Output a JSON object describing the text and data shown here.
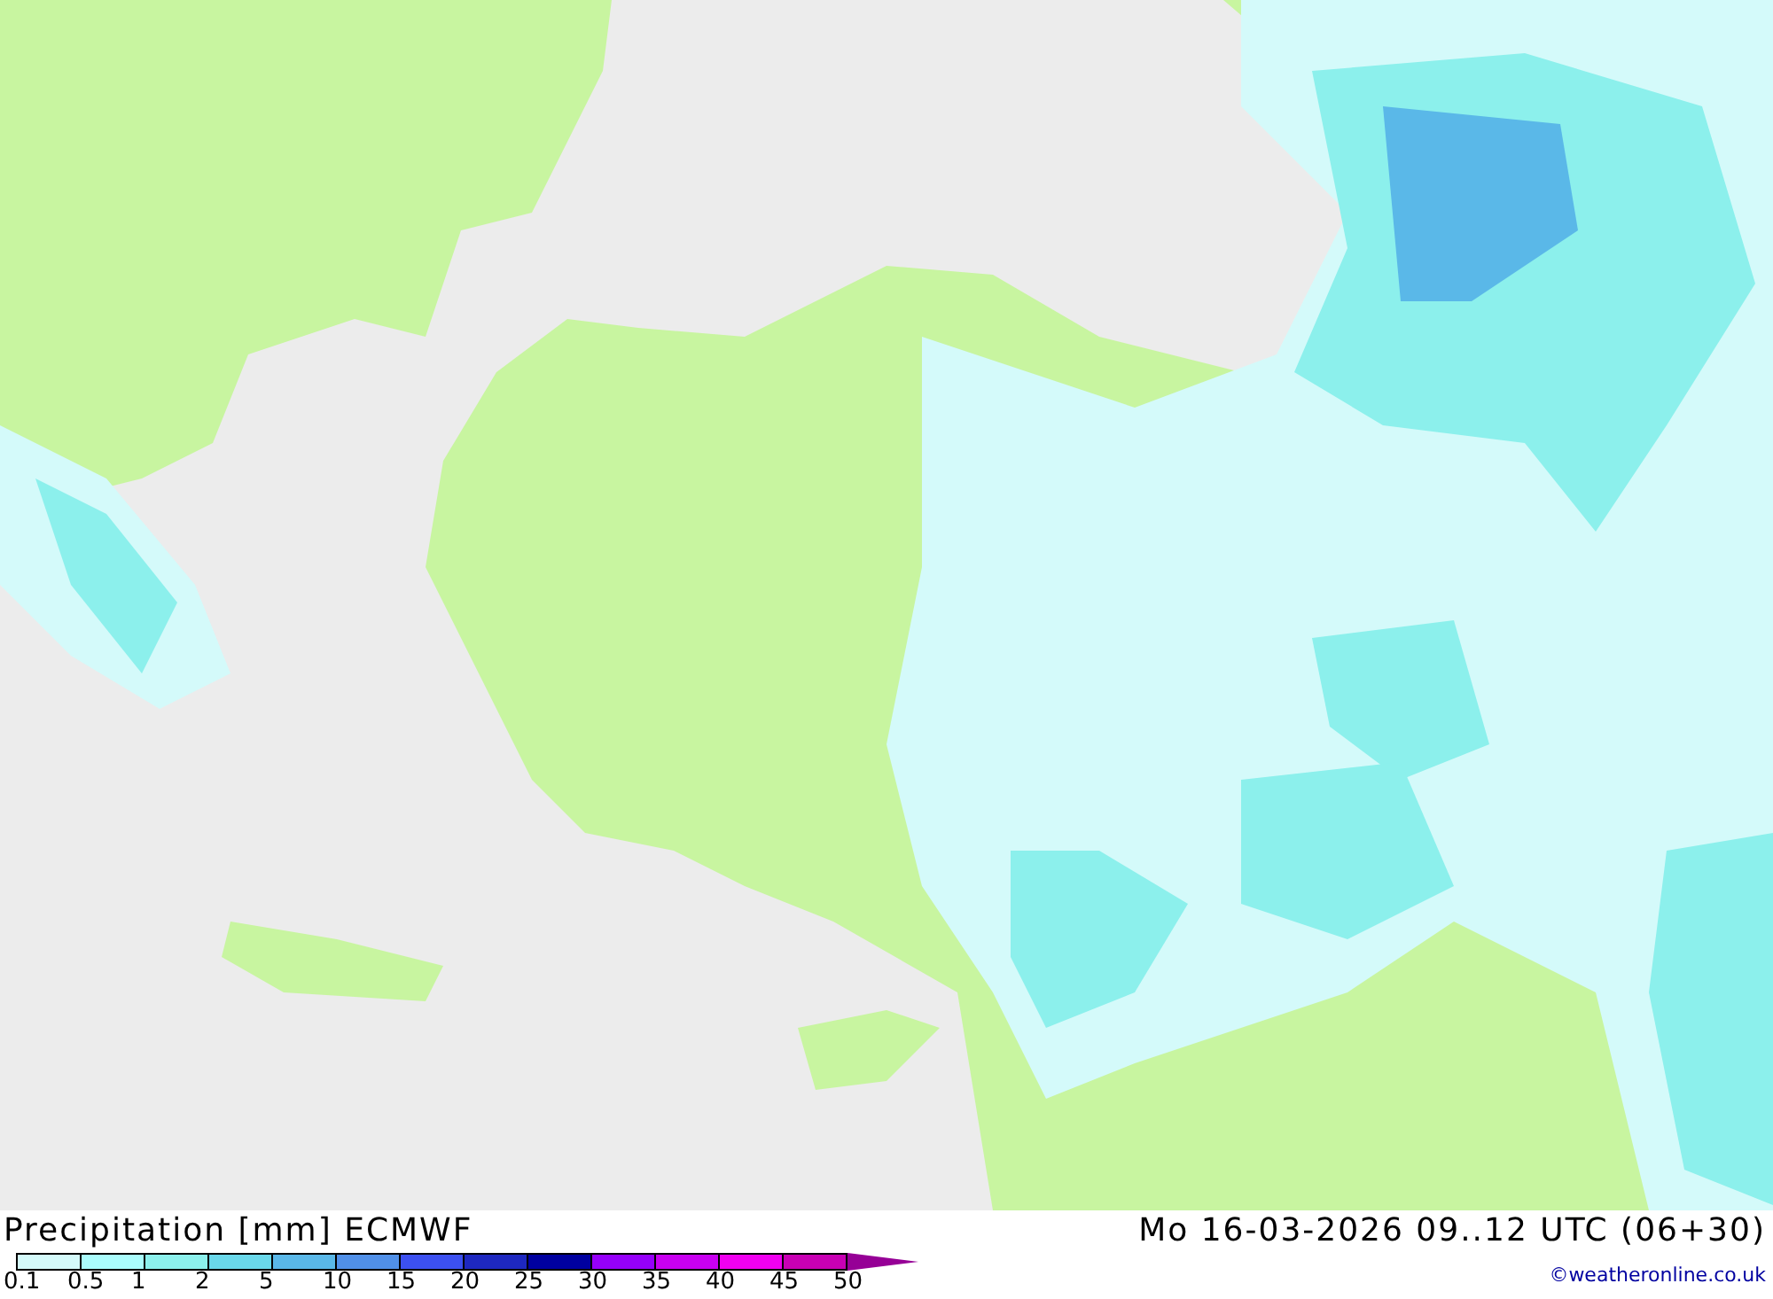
{
  "title": "Precipitation [mm] ECMWF",
  "valid_time": "Mo 16-03-2026 09..12 UTC (06+30)",
  "credit": "©weatheronline.co.uk",
  "legend": {
    "bins": [
      {
        "color": "#d4fafa"
      },
      {
        "color": "#aafcfc"
      },
      {
        "color": "#8cf0ec"
      },
      {
        "color": "#6ad8ea"
      },
      {
        "color": "#5ab8e8"
      },
      {
        "color": "#5090e8"
      },
      {
        "color": "#3c50f0"
      },
      {
        "color": "#1e28c0"
      },
      {
        "color": "#0000a0"
      },
      {
        "color": "#9600fa"
      },
      {
        "color": "#c800f0"
      },
      {
        "color": "#f000f0"
      },
      {
        "color": "#c800b4"
      },
      {
        "kind": "arrow",
        "color": "#960096"
      }
    ],
    "ticks": [
      "0.1",
      "0.5",
      "1",
      "2",
      "5",
      "10",
      "15",
      "20",
      "25",
      "30",
      "35",
      "40",
      "45",
      "50"
    ]
  }
}
